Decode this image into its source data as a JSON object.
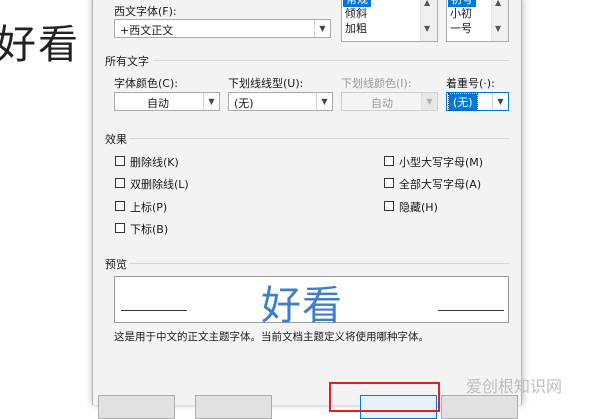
{
  "document": {
    "background_text": "好看"
  },
  "dialog": {
    "western_font": {
      "label": "西文字体(F):",
      "value": "+西文正文"
    },
    "style_list": {
      "items": [
        "常规",
        "倾斜",
        "加粗"
      ],
      "selected": "常规"
    },
    "size_list": {
      "items": [
        "初号",
        "小初",
        "一号"
      ],
      "selected": "初号"
    },
    "all_text": {
      "title": "所有文字",
      "font_color": {
        "label": "字体颜色(C):",
        "value": "自动"
      },
      "underline_type": {
        "label": "下划线线型(U):",
        "value": "(无)"
      },
      "underline_color": {
        "label": "下划线颜色(I):",
        "value": "自动"
      },
      "emphasis_mark": {
        "label": "着重号(·):",
        "value": "(无)"
      }
    },
    "effects": {
      "title": "效果",
      "items": {
        "strikethrough": "删除线(K)",
        "double_strikethrough": "双删除线(L)",
        "superscript": "上标(P)",
        "subscript": "下标(B)",
        "small_caps": "小型大写字母(M)",
        "all_caps": "全部大写字母(A)",
        "hidden": "隐藏(H)"
      }
    },
    "preview": {
      "title": "预览",
      "sample_text": "好看",
      "description": "这是用于中文的正文主题字体。当前文档主题定义将使用哪种字体。"
    }
  },
  "watermark": "爱创根知识网",
  "colors": {
    "selection": "#0078d7",
    "preview_text": "#3f7fc8",
    "highlight_box": "#e02020"
  }
}
